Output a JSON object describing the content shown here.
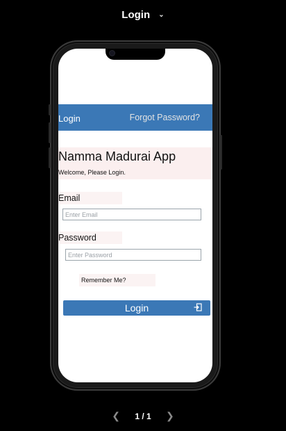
{
  "topbar": {
    "title": "Login"
  },
  "appbar": {
    "title": "Login",
    "forgot": "Forgot Password?"
  },
  "hero": {
    "name": "Namma Madurai App",
    "welcome": "Welcome, Please Login."
  },
  "form": {
    "email_label": "Email",
    "email_placeholder": "Enter Email",
    "password_label": "Password",
    "password_placeholder": "Enter Password",
    "remember": "Remember Me?",
    "login_button": "Login"
  },
  "pager": {
    "current": 1,
    "total": 1,
    "text": "1 / 1"
  },
  "colors": {
    "primary": "#3b78b6",
    "hero_bg": "#fbefef",
    "screen_bg": "#ffffff",
    "frame_bg": "#000000"
  }
}
